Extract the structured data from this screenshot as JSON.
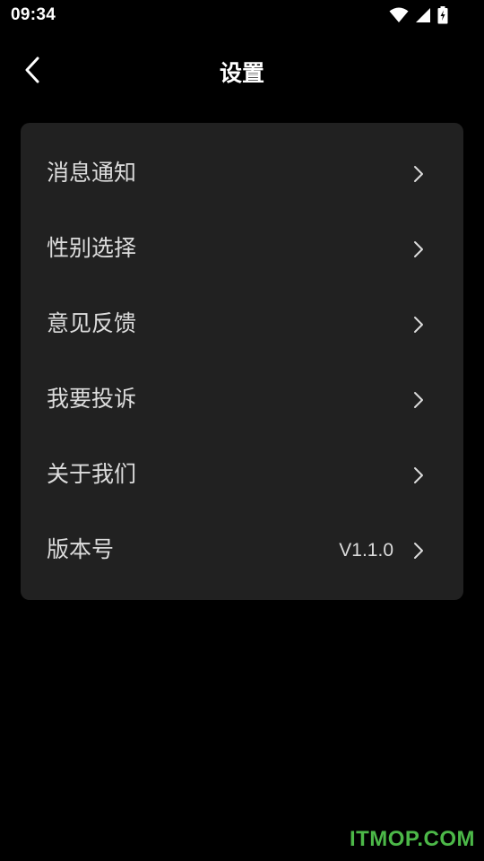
{
  "status_bar": {
    "time": "09:34",
    "icons": [
      "wifi-icon",
      "signal-icon",
      "battery-charging-icon"
    ]
  },
  "header": {
    "title": "设置",
    "back_icon": "chevron-left-icon"
  },
  "settings": {
    "items": [
      {
        "label": "消息通知",
        "value": ""
      },
      {
        "label": "性别选择",
        "value": ""
      },
      {
        "label": "意见反馈",
        "value": ""
      },
      {
        "label": "我要投诉",
        "value": ""
      },
      {
        "label": "关于我们",
        "value": ""
      },
      {
        "label": "版本号",
        "value": "V1.1.0"
      }
    ]
  },
  "watermark": "ITMOP.COM",
  "colors": {
    "background": "#000000",
    "card": "#212121",
    "text": "#dcdcdc",
    "watermark": "#4cb848"
  }
}
